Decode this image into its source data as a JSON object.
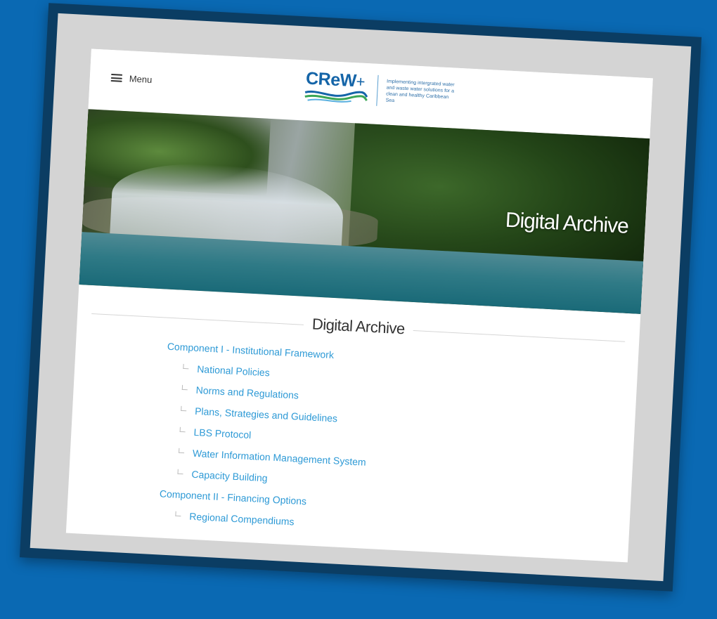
{
  "header": {
    "menu_label": "Menu",
    "logo_text": "CReW",
    "logo_plus": "+",
    "logo_tagline": "Implementing intergrated water and waste water solutions for a clean and healthy Caribbean Sea"
  },
  "hero": {
    "title": "Digital Archive"
  },
  "archive": {
    "heading": "Digital Archive",
    "items": [
      {
        "label": "Component I - Institutional Framework",
        "level": 0
      },
      {
        "label": "National Policies",
        "level": 1
      },
      {
        "label": "Norms and Regulations",
        "level": 1
      },
      {
        "label": "Plans, Strategies and Guidelines",
        "level": 1
      },
      {
        "label": "LBS Protocol",
        "level": 1
      },
      {
        "label": "Water Information Management System",
        "level": 1
      },
      {
        "label": "Capacity Building",
        "level": 1
      },
      {
        "label": "Component II - Financing Options",
        "level": 0
      },
      {
        "label": "Regional Compendiums",
        "level": 1
      }
    ]
  },
  "colors": {
    "background": "#0a69b3",
    "frame": "#0b3d63",
    "mat": "#d4d4d4",
    "link": "#2e9ad6",
    "logo": "#1565a8"
  }
}
